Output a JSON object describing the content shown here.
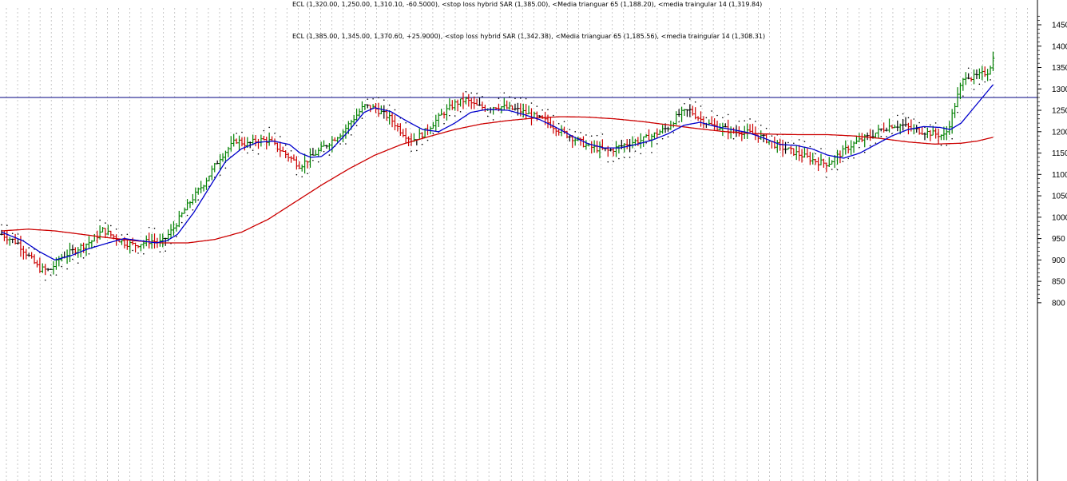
{
  "header": {
    "line1": "ECL (1,320.00, 1,250.00, 1,310.10, -60.5000), <stop loss hybrid SAR (1,385.00), <Media trianguar 65 (1,188.20), <media traingular 14 (1,319.84)",
    "line2": "ECL (1,385.00, 1,345.00, 1,370.60, +25.9000), <stop loss hybrid SAR (1,342.38), <Media trianguar 65 (1,185.56), <media traingular 14 (1,308.31)"
  },
  "colors": {
    "background": "#ffffff",
    "grid": "#b0b0b0",
    "up_bar": "#008000",
    "down_bar": "#cc0000",
    "neutral_bar": "#000000",
    "ma_fast": "#0000cc",
    "ma_slow": "#cc0000",
    "horizontal_line": "#000080"
  },
  "chart_data": {
    "type": "line",
    "subtype": "ohlc price chart with moving averages",
    "title": "",
    "xlabel": "",
    "ylabel": "",
    "ylim": [
      790,
      1490
    ],
    "y_ticks": [
      800,
      850,
      900,
      950,
      1000,
      1050,
      1100,
      1150,
      1200,
      1250,
      1300,
      1350,
      1400,
      1450
    ],
    "y_axis_side": "right",
    "grid": "vertical dotted",
    "horizontal_line": 1280,
    "bar_count": 200,
    "price_path": [
      [
        0,
        960
      ],
      [
        6,
        940
      ],
      [
        10,
        910
      ],
      [
        14,
        880
      ],
      [
        18,
        875
      ],
      [
        22,
        905
      ],
      [
        28,
        925
      ],
      [
        34,
        945
      ],
      [
        38,
        970
      ],
      [
        42,
        955
      ],
      [
        46,
        940
      ],
      [
        50,
        935
      ],
      [
        56,
        945
      ],
      [
        60,
        940
      ],
      [
        64,
        970
      ],
      [
        70,
        1030
      ],
      [
        76,
        1080
      ],
      [
        82,
        1140
      ],
      [
        88,
        1180
      ],
      [
        92,
        1170
      ],
      [
        96,
        1180
      ],
      [
        100,
        1180
      ],
      [
        104,
        1160
      ],
      [
        108,
        1140
      ],
      [
        112,
        1120
      ],
      [
        116,
        1140
      ],
      [
        120,
        1160
      ],
      [
        124,
        1180
      ],
      [
        128,
        1200
      ],
      [
        132,
        1230
      ],
      [
        136,
        1260
      ],
      [
        140,
        1255
      ],
      [
        146,
        1230
      ],
      [
        150,
        1200
      ],
      [
        154,
        1180
      ],
      [
        158,
        1195
      ],
      [
        162,
        1220
      ],
      [
        166,
        1245
      ],
      [
        170,
        1265
      ],
      [
        174,
        1275
      ],
      [
        178,
        1260
      ],
      [
        182,
        1255
      ],
      [
        186,
        1260
      ],
      [
        190,
        1255
      ],
      [
        194,
        1250
      ],
      [
        198,
        1240
      ],
      [
        204,
        1225
      ],
      [
        210,
        1200
      ],
      [
        216,
        1180
      ],
      [
        220,
        1165
      ],
      [
        224,
        1160
      ],
      [
        228,
        1155
      ],
      [
        232,
        1165
      ],
      [
        236,
        1175
      ],
      [
        240,
        1180
      ],
      [
        244,
        1190
      ],
      [
        250,
        1210
      ],
      [
        254,
        1240
      ],
      [
        258,
        1250
      ],
      [
        262,
        1230
      ],
      [
        266,
        1215
      ],
      [
        270,
        1210
      ],
      [
        274,
        1200
      ],
      [
        278,
        1200
      ],
      [
        282,
        1195
      ],
      [
        286,
        1185
      ],
      [
        290,
        1170
      ],
      [
        294,
        1160
      ],
      [
        298,
        1150
      ],
      [
        302,
        1140
      ],
      [
        306,
        1130
      ],
      [
        310,
        1125
      ],
      [
        314,
        1145
      ],
      [
        318,
        1165
      ],
      [
        322,
        1180
      ],
      [
        326,
        1190
      ],
      [
        330,
        1205
      ],
      [
        334,
        1215
      ],
      [
        338,
        1215
      ],
      [
        342,
        1205
      ],
      [
        346,
        1200
      ],
      [
        350,
        1195
      ],
      [
        354,
        1190
      ],
      [
        356,
        1225
      ],
      [
        358,
        1270
      ],
      [
        360,
        1310
      ],
      [
        362,
        1335
      ],
      [
        364,
        1325
      ],
      [
        366,
        1330
      ],
      [
        368,
        1335
      ],
      [
        370,
        1340
      ],
      [
        372,
        1370
      ]
    ],
    "series": [
      {
        "name": "media traingular 14",
        "color": "#0000cc",
        "points": [
          [
            0,
            965
          ],
          [
            8,
            945
          ],
          [
            14,
            920
          ],
          [
            20,
            900
          ],
          [
            26,
            910
          ],
          [
            32,
            925
          ],
          [
            40,
            940
          ],
          [
            46,
            950
          ],
          [
            52,
            945
          ],
          [
            58,
            940
          ],
          [
            62,
            945
          ],
          [
            66,
            960
          ],
          [
            72,
            1010
          ],
          [
            78,
            1070
          ],
          [
            84,
            1130
          ],
          [
            90,
            1160
          ],
          [
            96,
            1175
          ],
          [
            102,
            1178
          ],
          [
            108,
            1170
          ],
          [
            112,
            1150
          ],
          [
            116,
            1140
          ],
          [
            120,
            1142
          ],
          [
            124,
            1160
          ],
          [
            130,
            1200
          ],
          [
            136,
            1245
          ],
          [
            140,
            1256
          ],
          [
            146,
            1247
          ],
          [
            152,
            1225
          ],
          [
            158,
            1205
          ],
          [
            164,
            1200
          ],
          [
            170,
            1220
          ],
          [
            176,
            1245
          ],
          [
            182,
            1252
          ],
          [
            190,
            1250
          ],
          [
            196,
            1240
          ],
          [
            202,
            1228
          ],
          [
            208,
            1210
          ],
          [
            214,
            1190
          ],
          [
            220,
            1172
          ],
          [
            226,
            1162
          ],
          [
            232,
            1162
          ],
          [
            238,
            1170
          ],
          [
            244,
            1180
          ],
          [
            250,
            1195
          ],
          [
            256,
            1215
          ],
          [
            262,
            1222
          ],
          [
            268,
            1212
          ],
          [
            274,
            1205
          ],
          [
            280,
            1198
          ],
          [
            286,
            1185
          ],
          [
            292,
            1170
          ],
          [
            298,
            1168
          ],
          [
            304,
            1160
          ],
          [
            310,
            1145
          ],
          [
            316,
            1138
          ],
          [
            322,
            1150
          ],
          [
            328,
            1170
          ],
          [
            334,
            1190
          ],
          [
            340,
            1205
          ],
          [
            346,
            1212
          ],
          [
            352,
            1210
          ],
          [
            356,
            1205
          ],
          [
            360,
            1220
          ],
          [
            364,
            1250
          ],
          [
            368,
            1280
          ],
          [
            372,
            1310
          ]
        ]
      },
      {
        "name": "Media trianguar 65",
        "color": "#cc0000",
        "points": [
          [
            0,
            968
          ],
          [
            10,
            972
          ],
          [
            20,
            968
          ],
          [
            30,
            960
          ],
          [
            40,
            952
          ],
          [
            50,
            945
          ],
          [
            60,
            940
          ],
          [
            70,
            940
          ],
          [
            80,
            948
          ],
          [
            90,
            965
          ],
          [
            100,
            995
          ],
          [
            110,
            1035
          ],
          [
            120,
            1075
          ],
          [
            130,
            1112
          ],
          [
            140,
            1145
          ],
          [
            150,
            1170
          ],
          [
            160,
            1188
          ],
          [
            170,
            1205
          ],
          [
            180,
            1218
          ],
          [
            190,
            1226
          ],
          [
            200,
            1232
          ],
          [
            210,
            1235
          ],
          [
            220,
            1234
          ],
          [
            230,
            1230
          ],
          [
            240,
            1224
          ],
          [
            250,
            1216
          ],
          [
            260,
            1208
          ],
          [
            270,
            1201
          ],
          [
            280,
            1196
          ],
          [
            290,
            1194
          ],
          [
            300,
            1193
          ],
          [
            310,
            1193
          ],
          [
            320,
            1190
          ],
          [
            330,
            1184
          ],
          [
            340,
            1176
          ],
          [
            350,
            1171
          ],
          [
            360,
            1173
          ],
          [
            366,
            1178
          ],
          [
            372,
            1187
          ]
        ]
      }
    ]
  }
}
